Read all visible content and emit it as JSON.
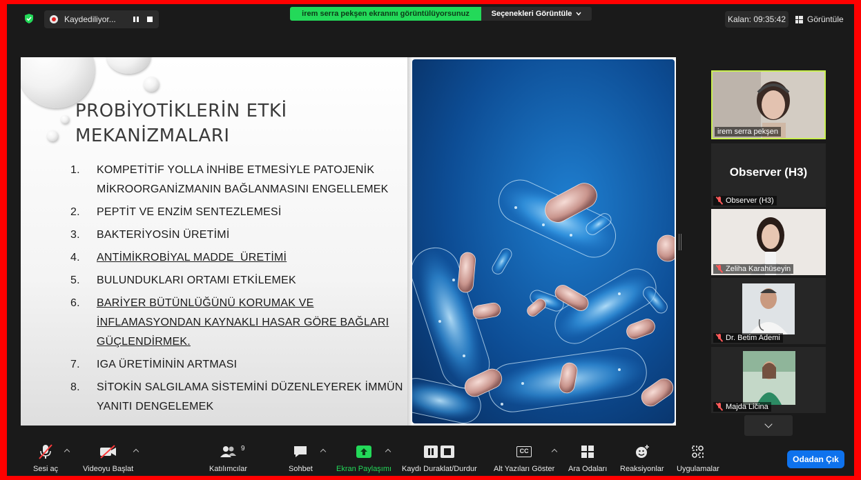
{
  "top_bar": {
    "recording_label": "Kaydediliyor...",
    "share_banner": "irem serra pekşen ekranını görüntülüyorsunuz",
    "view_options": "Seçenekleri Görüntüle",
    "timer": "Kalan: 09:35:42",
    "view_label": "Görüntüle"
  },
  "slide": {
    "title_line1": "PROBİYOTİKLERİN ETKİ",
    "title_line2": "MEKANİZMALARI",
    "items": [
      {
        "num": "1.",
        "line1": "KOMPETİTİF YOLLA İNHİBE ETMESİYLE PATOJENİK",
        "line2": "MİKROORGANİZMANIN BAĞLANMASINI ENGELLEMEK",
        "line3": ""
      },
      {
        "num": "2.",
        "line1": "PEPTİT VE ENZİM SENTEZLEMESİ",
        "line2": "",
        "line3": ""
      },
      {
        "num": "3.",
        "line1": "BAKTERİYOSİN ÜRETİMİ",
        "line2": "",
        "line3": ""
      },
      {
        "num": "4.",
        "line1": "ANTİMİKROBİYAL MADDE  ÜRETİMİ",
        "line2": "",
        "line3": ""
      },
      {
        "num": "5.",
        "line1": "BULUNDUKLARI ORTAMI ETKİLEMEK",
        "line2": "",
        "line3": ""
      },
      {
        "num": "6.",
        "line1": "BARİYER BÜTÜNLÜĞÜNÜ KORUMAK VE",
        "line2": "İNFLAMASYONDAN KAYNAKLI HASAR GÖRE BAĞLARI",
        "line3": "GÜÇLENDİRMEK."
      },
      {
        "num": "7.",
        "line1": "IGA ÜRETİMİNİN ARTMASI",
        "line2": "",
        "line3": ""
      },
      {
        "num": "8.",
        "line1": "SİTOKİN SALGILAMA SİSTEMİNİ DÜZENLEYEREK İMMÜN",
        "line2": "YANITI DENGELEMEK",
        "line3": ""
      }
    ]
  },
  "participants": [
    {
      "name": "irem serra pekşen",
      "muted": false
    },
    {
      "name": "Observer (H3)",
      "display": "Observer (H3)",
      "muted": true
    },
    {
      "name": "Zeliha Karahüseyin",
      "muted": true
    },
    {
      "name": "Dr. Betim Ademi",
      "muted": true
    },
    {
      "name": "Majda Ličina",
      "muted": true
    }
  ],
  "toolbar": {
    "unmute": "Sesi aç",
    "start_video": "Videoyu Başlat",
    "participants": "Katılımcılar",
    "participants_count": "9",
    "chat": "Sohbet",
    "share_screen": "Ekran Paylaşımı",
    "pause_stop_recording": "Kaydı Duraklat/Durdur",
    "captions": "Alt Yazıları Göster",
    "cc_badge": "CC",
    "breakout_rooms": "Ara Odaları",
    "reactions": "Reaksiyonlar",
    "apps": "Uygulamalar",
    "leave_room": "Odadan Çık"
  },
  "colors": {
    "share_green": "#23d959",
    "active_speaker_border": "#c9f050",
    "leave_blue": "#0e72ed",
    "muted_red": "#ff5a5a",
    "frame_red": "#ff0000"
  }
}
